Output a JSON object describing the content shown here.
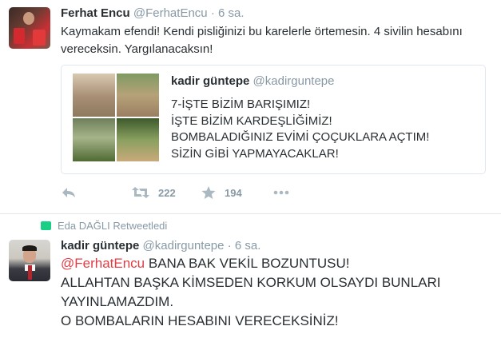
{
  "tweet1": {
    "name": "Ferhat Encu",
    "handle": "@FerhatEncu",
    "dot": "·",
    "time": "6 sa.",
    "text_line1": "Kaymakam efendi! Kendi pisliğinizi bu karelerle örtemesin. 4 sivilin hesabını",
    "text_line2": "vereceksin. Yargılanacaksın!",
    "quote": {
      "name": "kadir güntepe",
      "handle": "@kadirguntepe",
      "lines": [
        "7-İŞTE BİZİM BARIŞIMIZ!",
        "İŞTE BİZİM KARDEŞLİĞİMİZ!",
        "BOMBALADIĞINIZ EVİMİ ÇOÇUKLARA AÇTIM!",
        "SİZİN GİBİ YAPMAYACAKLAR!"
      ]
    },
    "retweets": "222",
    "favorites": "194",
    "icons": [
      "reply-icon",
      "retweet-icon",
      "favorite-icon",
      "more-icon"
    ]
  },
  "tweet2": {
    "retweeted_by": "Eda DAĞLI Retweetledi",
    "name": "kadir güntepe",
    "handle": "@kadirguntepe",
    "dot": "·",
    "time": "6 sa.",
    "mention": "@FerhatEncu",
    "line1_rest": " BANA BAK VEKİL BOZUNTUSU!",
    "line2": "ALLAHTAN BAŞKA KİMSEDEN KORKUM OLSAYDI BUNLARI",
    "line3": "YAYINLAMAZDIM.",
    "line4": "O BOMBALARIN HESABINI VERECEKSİNİZ!"
  },
  "colors": {
    "mention": "#e23d45",
    "retweet_green": "#19cf86",
    "muted": "#8899a6",
    "icon": "#aab8c2"
  }
}
